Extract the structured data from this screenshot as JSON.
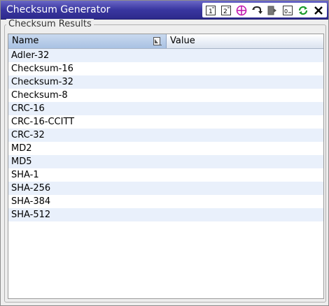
{
  "window": {
    "title": "Checksum Generator"
  },
  "toolbar": {
    "buttons": [
      {
        "icon": "text-one-icon",
        "label": "1"
      },
      {
        "icon": "text-two-icon",
        "label": "2"
      },
      {
        "icon": "crosshair-icon"
      },
      {
        "icon": "undo-arrow-icon"
      },
      {
        "icon": "page-icon"
      },
      {
        "icon": "document-icon"
      },
      {
        "icon": "refresh-icon"
      },
      {
        "icon": "close-icon"
      }
    ]
  },
  "group": {
    "label": "Checksum Results"
  },
  "table": {
    "columns": [
      "Name",
      "Value"
    ],
    "rows": [
      {
        "name": "Adler-32",
        "value": ""
      },
      {
        "name": "Checksum-16",
        "value": ""
      },
      {
        "name": "Checksum-32",
        "value": ""
      },
      {
        "name": "Checksum-8",
        "value": ""
      },
      {
        "name": "CRC-16",
        "value": ""
      },
      {
        "name": "CRC-16-CCITT",
        "value": ""
      },
      {
        "name": "CRC-32",
        "value": ""
      },
      {
        "name": "MD2",
        "value": ""
      },
      {
        "name": "MD5",
        "value": ""
      },
      {
        "name": "SHA-1",
        "value": ""
      },
      {
        "name": "SHA-256",
        "value": ""
      },
      {
        "name": "SHA-384",
        "value": ""
      },
      {
        "name": "SHA-512",
        "value": ""
      }
    ]
  },
  "colors": {
    "titlebar": "#3936a0",
    "row_alt": "#e9f0fb",
    "header_selected": "#a9c2e3",
    "refresh_icon": "#1a9a2a",
    "crosshair_icon": "#c21cb0"
  }
}
